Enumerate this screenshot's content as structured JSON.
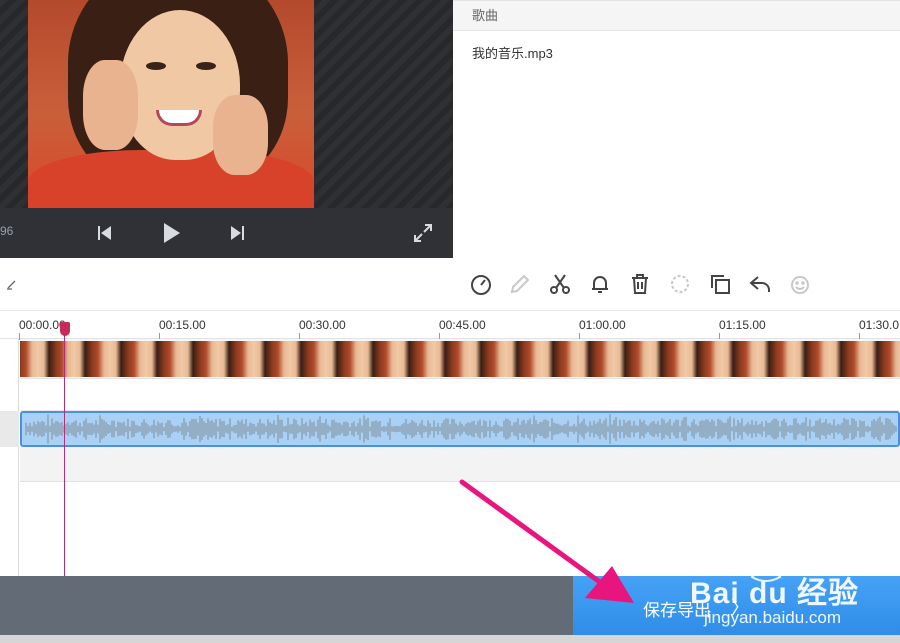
{
  "preview": {
    "time_fragment": "96"
  },
  "songs": {
    "header": "歌曲",
    "items": [
      "我的音乐.mp3"
    ]
  },
  "timeline": {
    "ticks": [
      "00:00.00",
      "00:15.00",
      "00:30.00",
      "00:45.00",
      "01:00.00",
      "01:15.00",
      "01:30.0"
    ]
  },
  "export": {
    "label": "保存导出",
    "chevron": "〉"
  },
  "watermark": {
    "brand": "Bai du 经验",
    "site": "jingyan.baidu.com"
  },
  "icons": [
    "prev-icon",
    "play-icon",
    "next-icon",
    "fullscreen-icon",
    "speed-icon",
    "pencil-icon",
    "scissors-icon",
    "bell-icon",
    "trash-icon",
    "split-icon",
    "copy-icon",
    "undo-icon",
    "emoji-icon"
  ],
  "colors": {
    "export_button": "#3496ea",
    "audio_track": "#a9d1f6",
    "playhead": "#c82a5a",
    "arrow": "#e8157f"
  }
}
